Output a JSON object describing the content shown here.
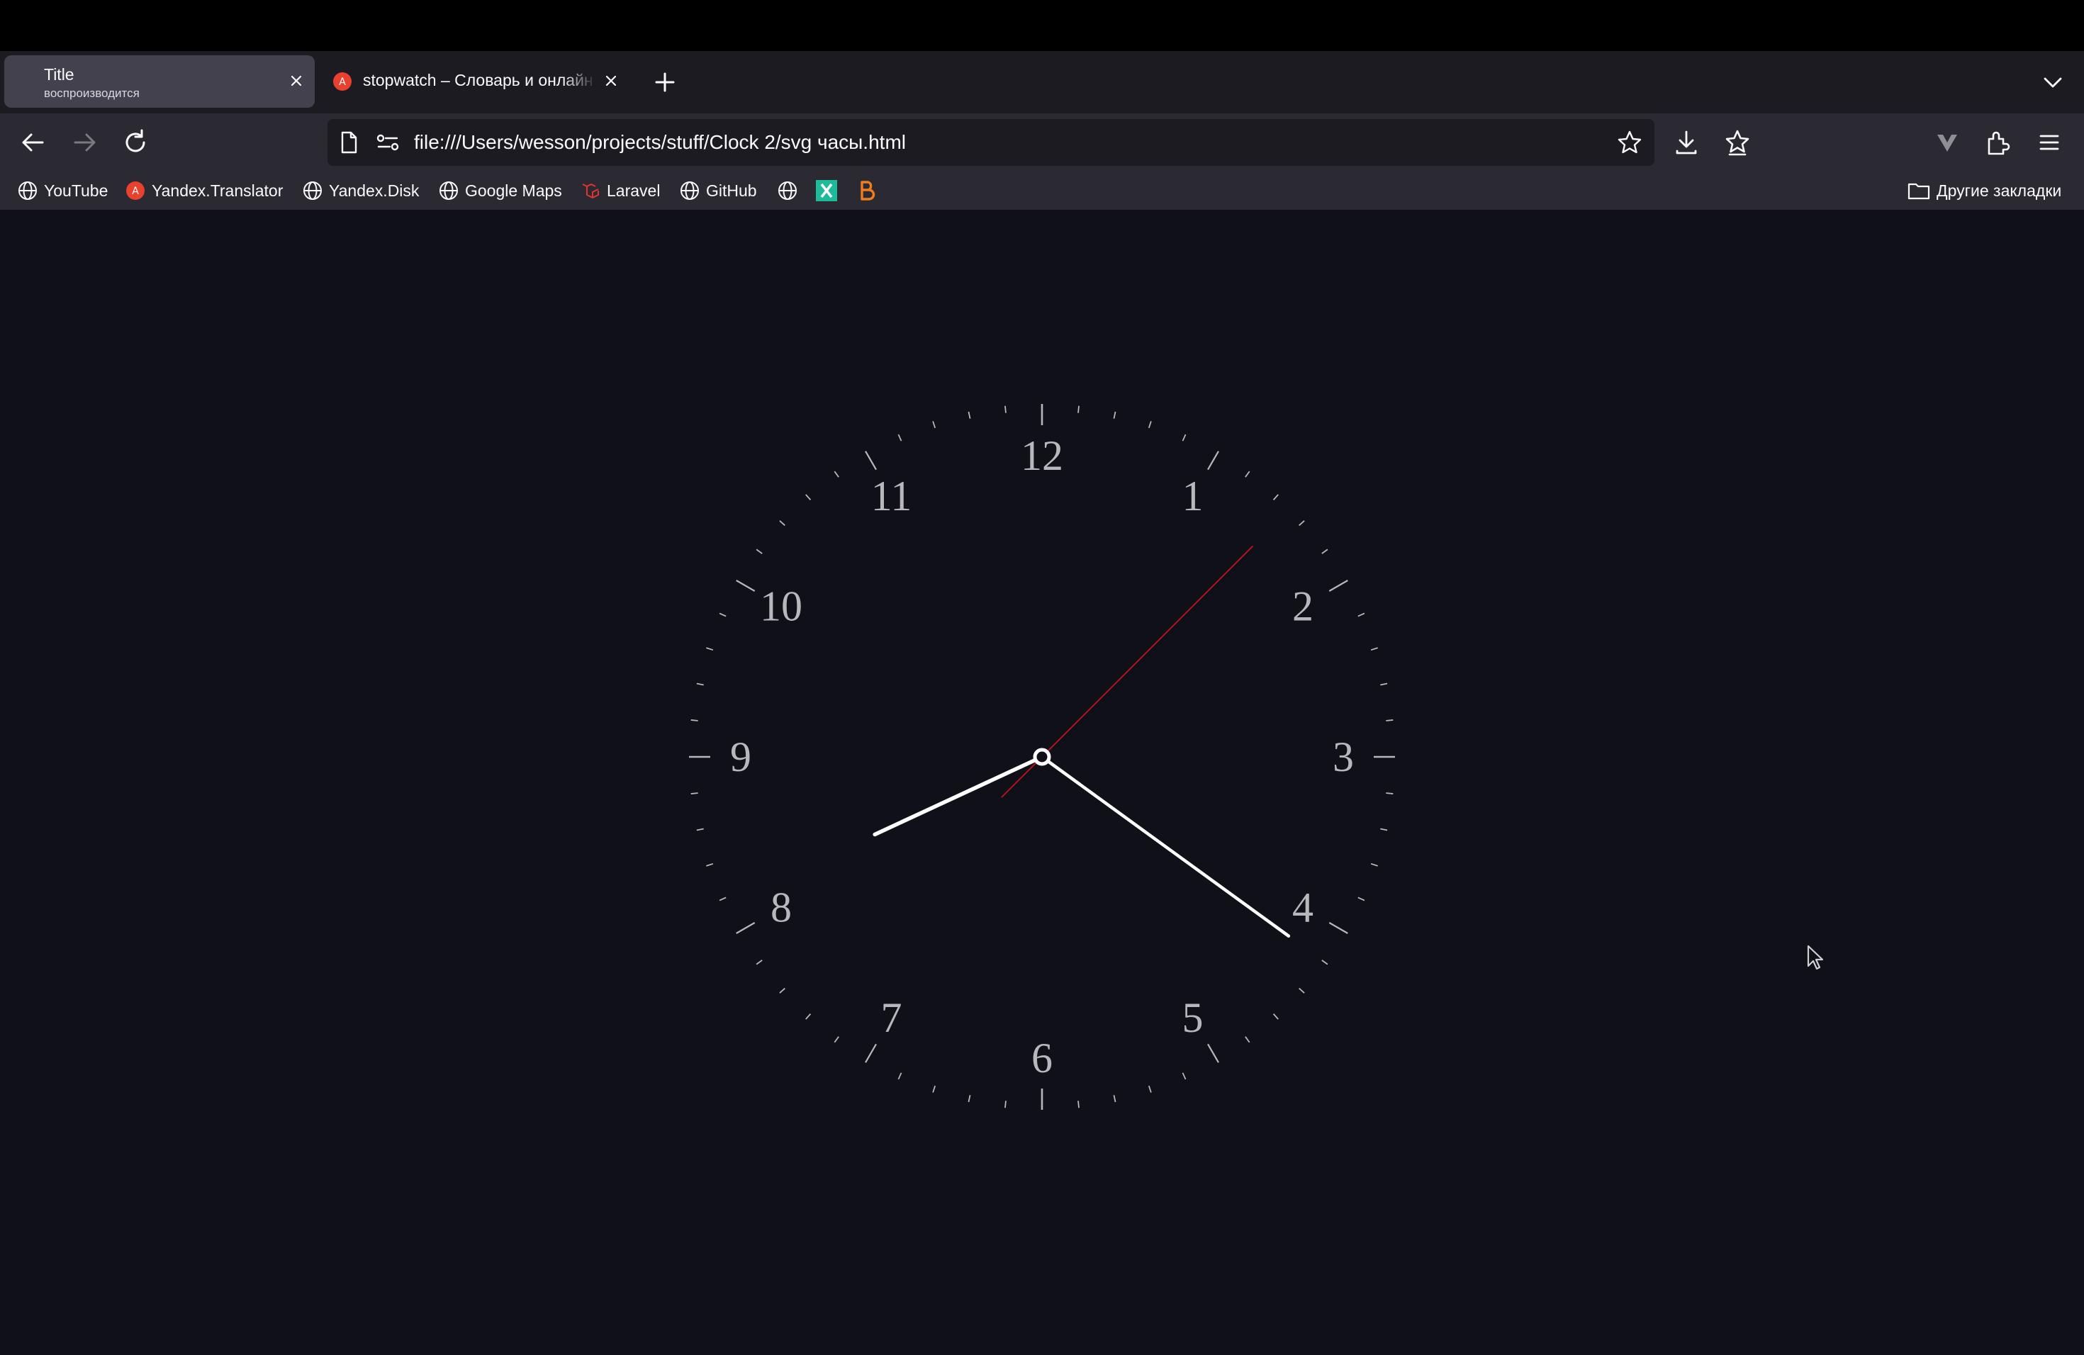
{
  "tabs": [
    {
      "title": "Title",
      "subtitle": "воспроизводится",
      "active": true
    },
    {
      "title": "stopwatch – Словарь и онлайн",
      "active": false
    }
  ],
  "navbar": {
    "url": "file:///Users/wesson/projects/stuff/Clock 2/svg часы.html"
  },
  "bookmarks": {
    "items": [
      {
        "label": "YouTube",
        "icon": "globe-icon"
      },
      {
        "label": "Yandex.Translator",
        "icon": "yandex-translate-icon"
      },
      {
        "label": "Yandex.Disk",
        "icon": "globe-icon"
      },
      {
        "label": "Google Maps",
        "icon": "globe-icon"
      },
      {
        "label": "Laravel",
        "icon": "laravel-icon"
      },
      {
        "label": "GitHub",
        "icon": "globe-icon"
      }
    ],
    "other_folder": "Другие закладки"
  },
  "clock": {
    "numerals": [
      "12",
      "1",
      "2",
      "3",
      "4",
      "5",
      "6",
      "7",
      "8",
      "9",
      "10",
      "11"
    ],
    "hour": 8.17,
    "minute": 21,
    "second": 7.5,
    "colors": {
      "hands": "#ffffff",
      "second_hand": "#b5121b",
      "ticks": "#b8b8bc",
      "background": "#0f1018"
    }
  }
}
